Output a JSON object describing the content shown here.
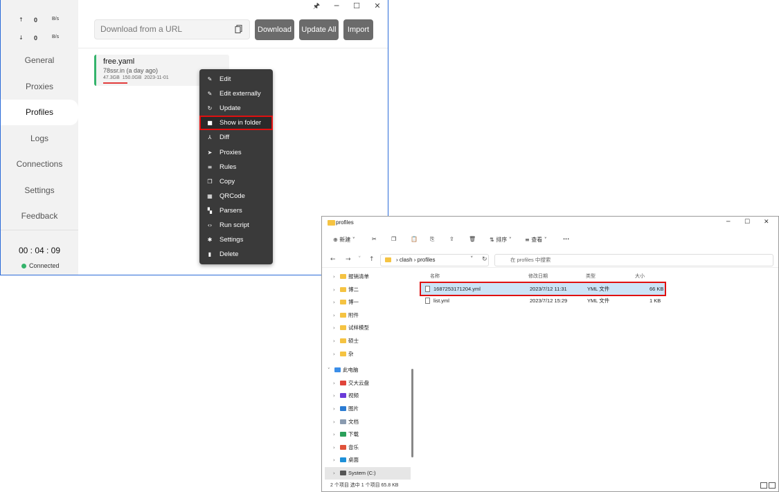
{
  "clash": {
    "titlebar": {
      "pin": "🖈",
      "minimize": "─",
      "maximize": "☐",
      "close": "✕"
    },
    "traffic": {
      "up": {
        "arrow": "↑",
        "value": "0",
        "unit": "B/s"
      },
      "down": {
        "arrow": "↓",
        "value": "0",
        "unit": "B/s"
      }
    },
    "nav": [
      "General",
      "Proxies",
      "Profiles",
      "Logs",
      "Connections",
      "Settings",
      "Feedback"
    ],
    "active_nav": "Profiles",
    "timer": "00 : 04 : 09",
    "status": "Connected",
    "url_placeholder": "Download from a URL",
    "buttons": {
      "download": "Download",
      "update_all": "Update All",
      "import": "Import"
    },
    "profile": {
      "name": "free.yaml",
      "source": "78ssr.in (a day ago)",
      "used": "47.3GB",
      "total": "150.0GB",
      "expire": "2023-11-01",
      "usage_fraction": 0.32
    },
    "context_menu": [
      {
        "icon": "✎",
        "label": "Edit"
      },
      {
        "icon": "✎",
        "label": "Edit externally"
      },
      {
        "icon": "↻",
        "label": "Update"
      },
      {
        "icon": "■",
        "label": "Show in folder"
      },
      {
        "icon": "⅄",
        "label": "Diff"
      },
      {
        "icon": "➤",
        "label": "Proxies"
      },
      {
        "icon": "≡",
        "label": "Rules"
      },
      {
        "icon": "❐",
        "label": "Copy"
      },
      {
        "icon": "▦",
        "label": "QRCode"
      },
      {
        "icon": "▚",
        "label": "Parsers"
      },
      {
        "icon": "‹›",
        "label": "Run script"
      },
      {
        "icon": "✱",
        "label": "Settings"
      },
      {
        "icon": "▮",
        "label": "Delete"
      }
    ],
    "highlighted_item": "Show in folder"
  },
  "explorer": {
    "title": "profiles",
    "winbtns": {
      "minimize": "─",
      "maximize": "☐",
      "close": "✕"
    },
    "toolbar": {
      "new": "⊕ 新建 ˅",
      "cut": "✂",
      "copy": "❐",
      "paste": "📋",
      "rename": "⎘",
      "share": "⇪",
      "delete": "🗑",
      "sort": "⇅ 排序 ˅",
      "view": "≡ 查看 ˅",
      "more": "···"
    },
    "nav": {
      "back": "←",
      "forward": "→",
      "down": "˅",
      "up": "↑",
      "refresh": "↻"
    },
    "breadcrumb": "›  clash  ›  profiles",
    "search_placeholder": "在 profiles 中搜索",
    "tree": [
      {
        "label": "报销清单",
        "icon": "folder"
      },
      {
        "label": "博二",
        "icon": "folder"
      },
      {
        "label": "博一",
        "icon": "folder"
      },
      {
        "label": "附件",
        "icon": "folder"
      },
      {
        "label": "试样模型",
        "icon": "folder"
      },
      {
        "label": "硕士",
        "icon": "folder"
      },
      {
        "label": "杂",
        "icon": "folder"
      },
      {
        "label": "此电脑",
        "icon": "pc"
      },
      {
        "label": "交大云盘",
        "icon": "cloud"
      },
      {
        "label": "视频",
        "icon": "video"
      },
      {
        "label": "图片",
        "icon": "picture"
      },
      {
        "label": "文档",
        "icon": "document"
      },
      {
        "label": "下载",
        "icon": "download"
      },
      {
        "label": "音乐",
        "icon": "music"
      },
      {
        "label": "桌面",
        "icon": "desktop"
      },
      {
        "label": "System (C:)",
        "icon": "drive"
      }
    ],
    "columns": {
      "name": "名称",
      "date": "修改日期",
      "type": "类型",
      "size": "大小"
    },
    "files": [
      {
        "name": "1687253171204.yml",
        "date": "2023/7/12 11:31",
        "type": "YML 文件",
        "size": "66 KB",
        "selected": true
      },
      {
        "name": "list.yml",
        "date": "2023/7/12 15:29",
        "type": "YML 文件",
        "size": "1 KB",
        "selected": false
      }
    ],
    "status": "2 个项目     选中 1 个项目  65.8 KB"
  }
}
